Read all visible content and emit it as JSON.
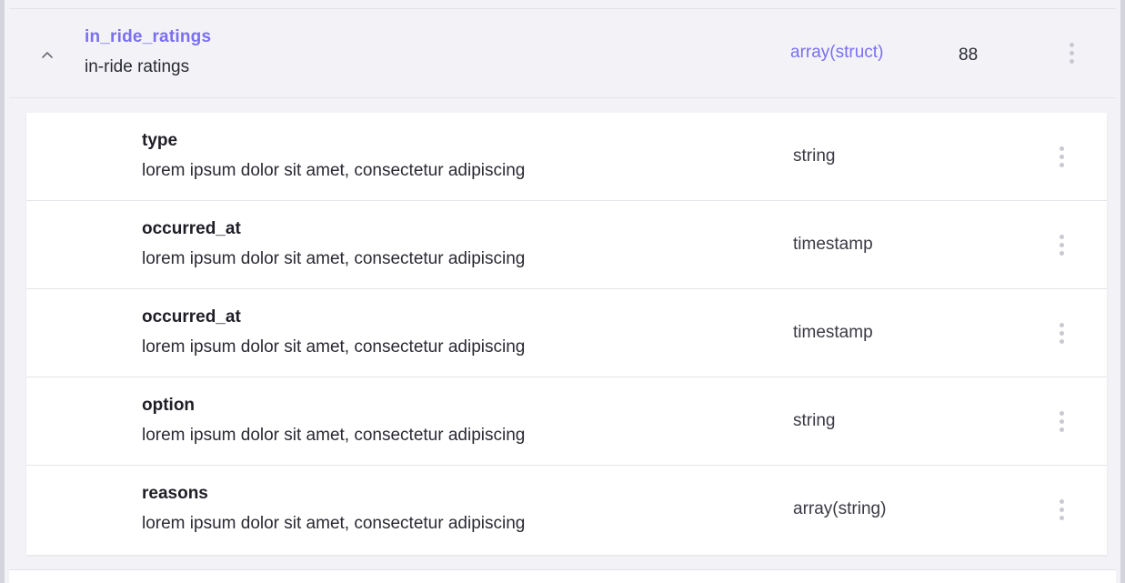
{
  "parent": {
    "name": "in_ride_ratings",
    "description": "in-ride ratings",
    "type": "array(struct)",
    "count": "88",
    "expand_icon": "chevron-up-icon",
    "menu_icon": "kebab-menu-icon"
  },
  "children": [
    {
      "name": "type",
      "description": "lorem ipsum dolor sit amet, consectetur adipiscing",
      "type": "string"
    },
    {
      "name": "occurred_at",
      "description": "lorem ipsum dolor sit amet, consectetur adipiscing",
      "type": "timestamp"
    },
    {
      "name": "occurred_at",
      "description": "lorem ipsum dolor sit amet, consectetur adipiscing",
      "type": "timestamp"
    },
    {
      "name": "option",
      "description": "lorem ipsum dolor sit amet, consectetur adipiscing",
      "type": "string"
    },
    {
      "name": "reasons",
      "description": "lorem ipsum dolor sit amet, consectetur adipiscing",
      "type": "array(string)"
    }
  ],
  "colors": {
    "accent": "#7a6ff0",
    "text": "#2a2a33",
    "panel": "#f3f3f7",
    "dot": "#c9c9d2"
  }
}
